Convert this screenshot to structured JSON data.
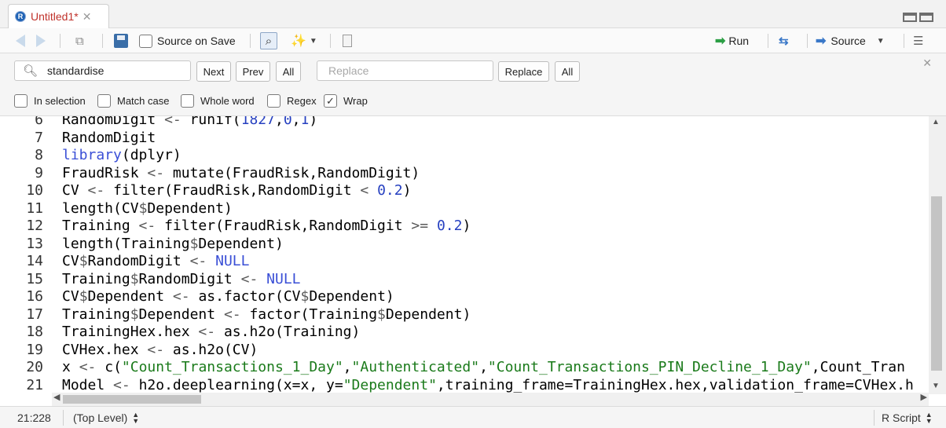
{
  "tab": {
    "title": "Untitled1*",
    "icon": "r-file-icon",
    "close": "✕"
  },
  "toolbar": {
    "source_on_save_label": "Source on Save",
    "run_label": "Run",
    "source_label": "Source"
  },
  "findbar": {
    "find_value": "standardise",
    "next_label": "Next",
    "prev_label": "Prev",
    "all_label": "All",
    "replace_placeholder": "Replace",
    "replace_label": "Replace",
    "replace_all_label": "All",
    "options": [
      {
        "label": "In selection",
        "checked": false
      },
      {
        "label": "Match case",
        "checked": false
      },
      {
        "label": "Whole word",
        "checked": false
      },
      {
        "label": "Regex",
        "checked": false
      },
      {
        "label": "Wrap",
        "checked": true
      }
    ]
  },
  "editor": {
    "lines": [
      {
        "num": "6",
        "text": "RandomDigit <- runif(1827,0,1)"
      },
      {
        "num": "7",
        "text": "RandomDigit"
      },
      {
        "num": "8",
        "text": "library(dplyr)"
      },
      {
        "num": "9",
        "text": "FraudRisk <- mutate(FraudRisk,RandomDigit)"
      },
      {
        "num": "10",
        "text": "CV <- filter(FraudRisk,RandomDigit < 0.2)"
      },
      {
        "num": "11",
        "text": "length(CV$Dependent)"
      },
      {
        "num": "12",
        "text": "Training <- filter(FraudRisk,RandomDigit >= 0.2)"
      },
      {
        "num": "13",
        "text": "length(Training$Dependent)"
      },
      {
        "num": "14",
        "text": "CV$RandomDigit <- NULL"
      },
      {
        "num": "15",
        "text": "Training$RandomDigit <- NULL"
      },
      {
        "num": "16",
        "text": "CV$Dependent <- as.factor(CV$Dependent)"
      },
      {
        "num": "17",
        "text": "Training$Dependent <- factor(Training$Dependent)"
      },
      {
        "num": "18",
        "text": "TrainingHex.hex <- as.h2o(Training)"
      },
      {
        "num": "19",
        "text": "CVHex.hex <- as.h2o(CV)"
      },
      {
        "num": "20",
        "text": "x <- c(\"Count_Transactions_1_Day\",\"Authenticated\",\"Count_Transactions_PIN_Decline_1_Day\",\"Count_Tran"
      },
      {
        "num": "21",
        "text": "Model <- h2o.deeplearning(x=x, y=\"Dependent\",training_frame=TrainingHex.hex,validation_frame=CVHex.h"
      }
    ]
  },
  "status": {
    "position": "21:228",
    "scope": "(Top Level)",
    "filetype": "R Script"
  },
  "colors": {
    "keyword": "#3a4fd6",
    "number": "#2640c0",
    "string": "#1a7a1a",
    "tab_title": "#c0322b"
  }
}
